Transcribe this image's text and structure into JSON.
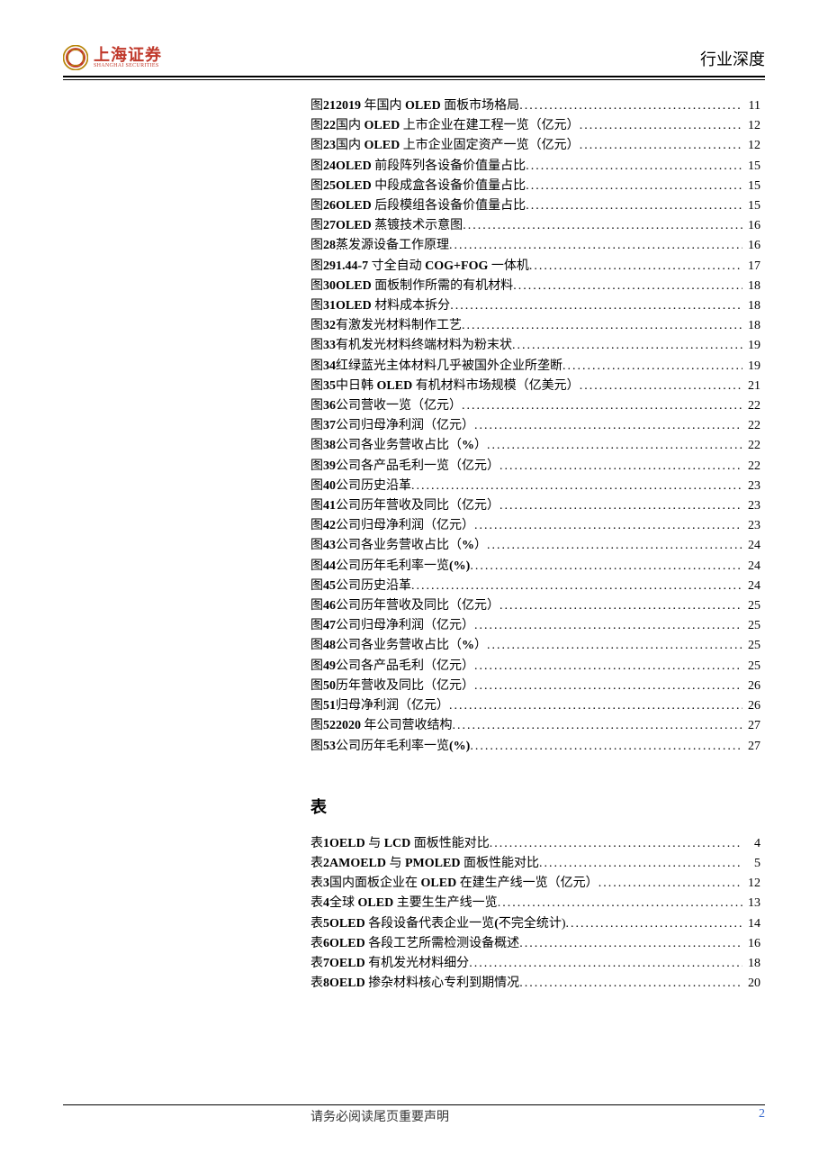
{
  "header": {
    "logo_cn": "上海证券",
    "logo_en": "SHANGHAI SECURITIES",
    "right_title": "行业深度"
  },
  "toc_figures_prefix": "图 ",
  "toc_tables_prefix": "表 ",
  "toc_figures": [
    {
      "num": "21",
      "title_pre": "",
      "lat": "2019",
      "title_mid": " 年国内 ",
      "lat2": "OLED",
      "title_post": " 面板市场格局",
      "page": "11"
    },
    {
      "num": "22",
      "title_pre": "国内 ",
      "lat": "OLED",
      "title_mid": " 上市企业在建工程一览（亿元）",
      "lat2": "",
      "title_post": "",
      "page": "12"
    },
    {
      "num": "23",
      "title_pre": "国内 ",
      "lat": "OLED",
      "title_mid": " 上市企业固定资产一览（亿元）",
      "lat2": "",
      "title_post": "",
      "page": "12"
    },
    {
      "num": "24",
      "title_pre": "",
      "lat": "OLED",
      "title_mid": " 前段阵列各设备价值量占比",
      "lat2": "",
      "title_post": "",
      "page": "15"
    },
    {
      "num": "25",
      "title_pre": "",
      "lat": "OLED",
      "title_mid": " 中段成盒各设备价值量占比",
      "lat2": "",
      "title_post": "",
      "page": "15"
    },
    {
      "num": "26",
      "title_pre": "",
      "lat": "OLED",
      "title_mid": " 后段模组各设备价值量占比",
      "lat2": "",
      "title_post": "",
      "page": "15"
    },
    {
      "num": "27",
      "title_pre": "",
      "lat": "OLED",
      "title_mid": " 蒸镀技术示意图",
      "lat2": "",
      "title_post": "",
      "page": "16"
    },
    {
      "num": "28",
      "title_pre": "蒸发源设备工作原理",
      "lat": "",
      "title_mid": "",
      "lat2": "",
      "title_post": "",
      "page": "16"
    },
    {
      "num": "29",
      "title_pre": "",
      "lat": "1.44-7",
      "title_mid": " 寸全自动 ",
      "lat2": "COG+FOG",
      "title_post": " 一体机",
      "page": "17"
    },
    {
      "num": "30",
      "title_pre": "",
      "lat": "OLED",
      "title_mid": " 面板制作所需的有机材料",
      "lat2": "",
      "title_post": "",
      "page": "18"
    },
    {
      "num": " 31",
      "title_pre": "",
      "lat": "OLED",
      "title_mid": " 材料成本拆分",
      "lat2": "",
      "title_post": "",
      "page": "18"
    },
    {
      "num": "32",
      "title_pre": "有激发光材料制作工艺",
      "lat": "",
      "title_mid": "",
      "lat2": "",
      "title_post": "",
      "page": "18"
    },
    {
      "num": "33",
      "title_pre": "有机发光材料终端材料为粉末状",
      "lat": "",
      "title_mid": "",
      "lat2": "",
      "title_post": "",
      "page": "19"
    },
    {
      "num": "34",
      "title_pre": "红绿蓝光主体材料几乎被国外企业所垄断",
      "lat": "",
      "title_mid": "",
      "lat2": "",
      "title_post": "",
      "page": "19"
    },
    {
      "num": "35",
      "title_pre": "中日韩 ",
      "lat": "OLED",
      "title_mid": " 有机材料市场规模（亿美元）",
      "lat2": "",
      "title_post": "",
      "page": "21"
    },
    {
      "num": "36",
      "title_pre": "公司营收一览（亿元）",
      "lat": "",
      "title_mid": "",
      "lat2": "",
      "title_post": "",
      "page": "22"
    },
    {
      "num": "37",
      "title_pre": "公司归母净利润（亿元）",
      "lat": "",
      "title_mid": "",
      "lat2": "",
      "title_post": "",
      "page": "22"
    },
    {
      "num": "38",
      "title_pre": "公司各业务营收占比（",
      "lat": "%",
      "title_mid": "）",
      "lat2": "",
      "title_post": "",
      "page": "22"
    },
    {
      "num": "39",
      "title_pre": "公司各产品毛利一览（亿元）",
      "lat": "",
      "title_mid": "",
      "lat2": "",
      "title_post": "",
      "page": "22"
    },
    {
      "num": "40",
      "title_pre": "公司历史沿革",
      "lat": "",
      "title_mid": "",
      "lat2": "",
      "title_post": "",
      "page": "23"
    },
    {
      "num": "41",
      "title_pre": "公司历年营收及同比（亿元）",
      "lat": "",
      "title_mid": "",
      "lat2": "",
      "title_post": "",
      "page": "23"
    },
    {
      "num": "42",
      "title_pre": "公司归母净利润（亿元）",
      "lat": "",
      "title_mid": "",
      "lat2": "",
      "title_post": "",
      "page": "23"
    },
    {
      "num": "43",
      "title_pre": "公司各业务营收占比（",
      "lat": "%",
      "title_mid": "）",
      "lat2": "",
      "title_post": "",
      "page": "24"
    },
    {
      "num": "44",
      "title_pre": "公司历年毛利率一览",
      "lat": "(%)",
      "title_mid": "",
      "lat2": "",
      "title_post": "",
      "page": "24"
    },
    {
      "num": "45",
      "title_pre": "公司历史沿革",
      "lat": "",
      "title_mid": "",
      "lat2": "",
      "title_post": "",
      "page": "24"
    },
    {
      "num": "46",
      "title_pre": "公司历年营收及同比（亿元）",
      "lat": "",
      "title_mid": "",
      "lat2": "",
      "title_post": "",
      "page": "25"
    },
    {
      "num": "47",
      "title_pre": "公司归母净利润（亿元）",
      "lat": "",
      "title_mid": "",
      "lat2": "",
      "title_post": "",
      "page": "25"
    },
    {
      "num": "48",
      "title_pre": "公司各业务营收占比（",
      "lat": "%",
      "title_mid": "）",
      "lat2": "",
      "title_post": "",
      "page": "25"
    },
    {
      "num": "49",
      "title_pre": "公司各产品毛利（亿元）",
      "lat": "",
      "title_mid": "",
      "lat2": "",
      "title_post": "",
      "page": "25"
    },
    {
      "num": "50",
      "title_pre": "历年营收及同比（亿元）",
      "lat": "",
      "title_mid": "",
      "lat2": "",
      "title_post": "",
      "page": "26"
    },
    {
      "num": "51",
      "title_pre": "归母净利润（亿元）",
      "lat": "",
      "title_mid": "",
      "lat2": "",
      "title_post": "",
      "page": "26"
    },
    {
      "num": "52",
      "title_pre": "",
      "lat": "2020",
      "title_mid": " 年公司营收结构",
      "lat2": "",
      "title_post": "",
      "page": "27"
    },
    {
      "num": "53",
      "title_pre": "公司历年毛利率一览",
      "lat": "(%)",
      "title_mid": "",
      "lat2": "",
      "title_post": "",
      "page": "27"
    }
  ],
  "tables_heading": "表",
  "toc_tables": [
    {
      "num": "1",
      "title_pre": "",
      "lat": "OELD",
      "title_mid": " 与 ",
      "lat2": "LCD",
      "title_post": " 面板性能对比",
      "page": "4"
    },
    {
      "num": "2",
      "title_pre": "",
      "lat": "AMOELD",
      "title_mid": " 与 ",
      "lat2": "PMOLED",
      "title_post": " 面板性能对比",
      "page": "5"
    },
    {
      "num": "3",
      "title_pre": "国内面板企业在 ",
      "lat": "OLED",
      "title_mid": " 在建生产线一览（亿元）",
      "lat2": "",
      "title_post": "",
      "page": "12"
    },
    {
      "num": "4",
      "title_pre": "全球 ",
      "lat": "OLED",
      "title_mid": " 主要生生产线一览",
      "lat2": "",
      "title_post": "",
      "page": "13"
    },
    {
      "num": "5",
      "title_pre": "",
      "lat": "OLED",
      "title_mid": " 各段设备代表企业一览",
      "lat2": "(",
      "title_post": "不完全统计)",
      "page": "14"
    },
    {
      "num": "6",
      "title_pre": "",
      "lat": "OLED",
      "title_mid": " 各段工艺所需检测设备概述",
      "lat2": "",
      "title_post": "",
      "page": "16"
    },
    {
      "num": "7",
      "title_pre": "",
      "lat": "OELD",
      "title_mid": " 有机发光材料细分",
      "lat2": "",
      "title_post": "",
      "page": "18"
    },
    {
      "num": "8",
      "title_pre": "",
      "lat": "OELD",
      "title_mid": " 掺杂材料核心专利到期情况",
      "lat2": "",
      "title_post": "",
      "page": "20"
    }
  ],
  "footer": {
    "note": "请务必阅读尾页重要声明",
    "page": "2"
  }
}
